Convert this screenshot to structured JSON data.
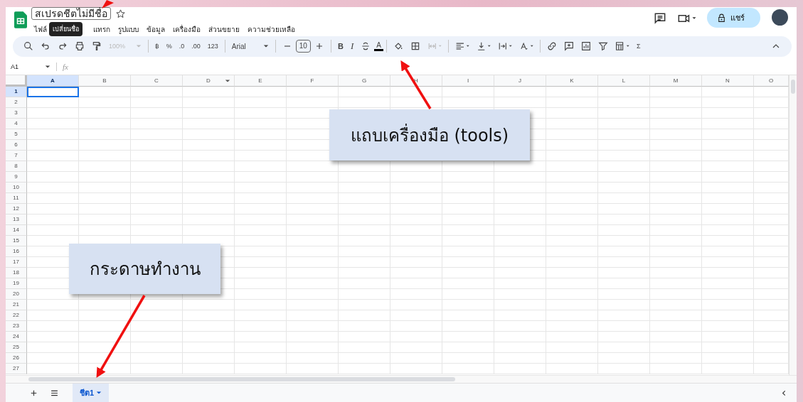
{
  "window": {
    "title": "สเปรดชีตไม่มีชื่อ",
    "tooltip": "เปลี่ยนชื่อ"
  },
  "menu": [
    "ไฟล์",
    "แทรก",
    "รูปแบบ",
    "ข้อมูล",
    "เครื่องมือ",
    "ส่วนขยาย",
    "ความช่วยเหลือ"
  ],
  "header": {
    "share_label": "แชร์"
  },
  "toolbar": {
    "zoom": "100%",
    "currency": "฿",
    "percent": "%",
    "decrease_decimal": ".0",
    "increase_decimal": ".00",
    "number_format": "123",
    "font": "Arial",
    "font_size": "10",
    "bold": "B",
    "italic": "I",
    "text_color": "A",
    "sum": "Σ"
  },
  "formula_bar": {
    "name_box": "A1",
    "formula_label": "fx"
  },
  "grid": {
    "columns": [
      {
        "label": "A",
        "selected": true
      },
      {
        "label": "B",
        "selected": false
      },
      {
        "label": "C",
        "selected": false
      },
      {
        "label": "D",
        "selected": false
      },
      {
        "label": "E",
        "selected": false
      },
      {
        "label": "F",
        "selected": false
      },
      {
        "label": "G",
        "selected": false
      },
      {
        "label": "H",
        "selected": false
      },
      {
        "label": "I",
        "selected": false
      },
      {
        "label": "J",
        "selected": false
      },
      {
        "label": "K",
        "selected": false
      },
      {
        "label": "L",
        "selected": false
      },
      {
        "label": "M",
        "selected": false
      },
      {
        "label": "N",
        "selected": false
      },
      {
        "label": "O",
        "selected": false
      }
    ],
    "rows": [
      {
        "label": "1",
        "selected": true
      },
      {
        "label": "2",
        "selected": false
      },
      {
        "label": "3",
        "selected": false
      },
      {
        "label": "4",
        "selected": false
      },
      {
        "label": "5",
        "selected": false
      },
      {
        "label": "6",
        "selected": false
      },
      {
        "label": "7",
        "selected": false
      },
      {
        "label": "8",
        "selected": false
      },
      {
        "label": "9",
        "selected": false
      },
      {
        "label": "10",
        "selected": false
      },
      {
        "label": "11",
        "selected": false
      },
      {
        "label": "12",
        "selected": false
      },
      {
        "label": "13",
        "selected": false
      },
      {
        "label": "14",
        "selected": false
      },
      {
        "label": "15",
        "selected": false
      },
      {
        "label": "16",
        "selected": false
      },
      {
        "label": "17",
        "selected": false
      },
      {
        "label": "18",
        "selected": false
      },
      {
        "label": "19",
        "selected": false
      },
      {
        "label": "20",
        "selected": false
      },
      {
        "label": "21",
        "selected": false
      },
      {
        "label": "22",
        "selected": false
      },
      {
        "label": "23",
        "selected": false
      },
      {
        "label": "24",
        "selected": false
      },
      {
        "label": "25",
        "selected": false
      },
      {
        "label": "26",
        "selected": false
      },
      {
        "label": "27",
        "selected": false
      }
    ]
  },
  "sheet_tabs": [
    {
      "label": "ชีต1",
      "selected": true
    }
  ],
  "annotations": [
    {
      "text": "แถบเครื่องมือ (tools)"
    },
    {
      "text": "กระดาษทำงาน"
    }
  ]
}
